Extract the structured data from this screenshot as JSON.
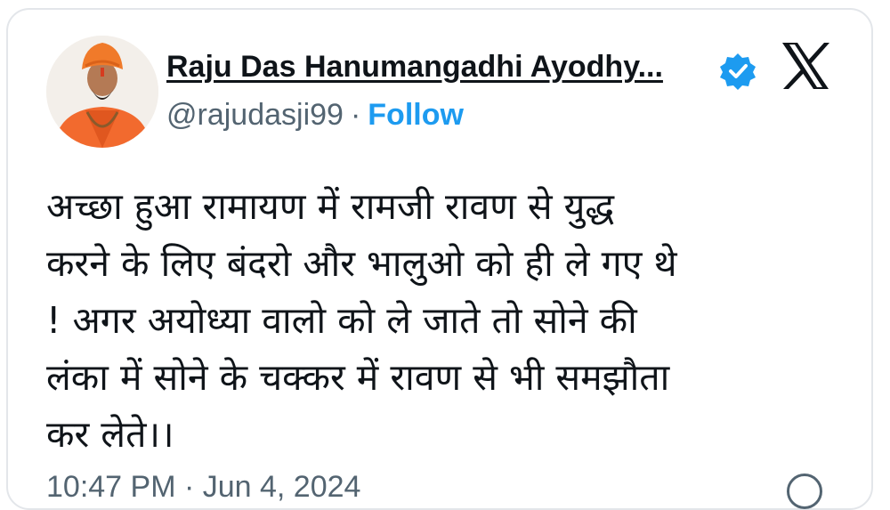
{
  "author": {
    "display_name": "Raju Das Hanumangadhi Ayodhy...",
    "handle": "@rajudasji99",
    "separator": "·",
    "follow_label": "Follow",
    "verified_icon": "verified-badge-icon",
    "verified_color": "#1d9bf0"
  },
  "platform_icon": "x-logo-icon",
  "tweet": {
    "lines": [
      "अच्छा हुआ रामायण में रामजी रावण से युद्ध",
      "करने के लिए बंदरो और भालुओ को ही ले गए थे",
      "! अगर अयोध्या वालो को ले जाते तो सोने की",
      "लंका में सोने के चक्कर में रावण से भी समझौता",
      "कर लेते।।"
    ]
  },
  "footer": {
    "timestamp": "10:47 PM · Jun 4, 2024",
    "info_icon": "info-icon"
  },
  "colors": {
    "text": "#0f1419",
    "secondary": "#536471",
    "accent": "#1d9bf0",
    "avatar_robe": "#f26a2e"
  }
}
